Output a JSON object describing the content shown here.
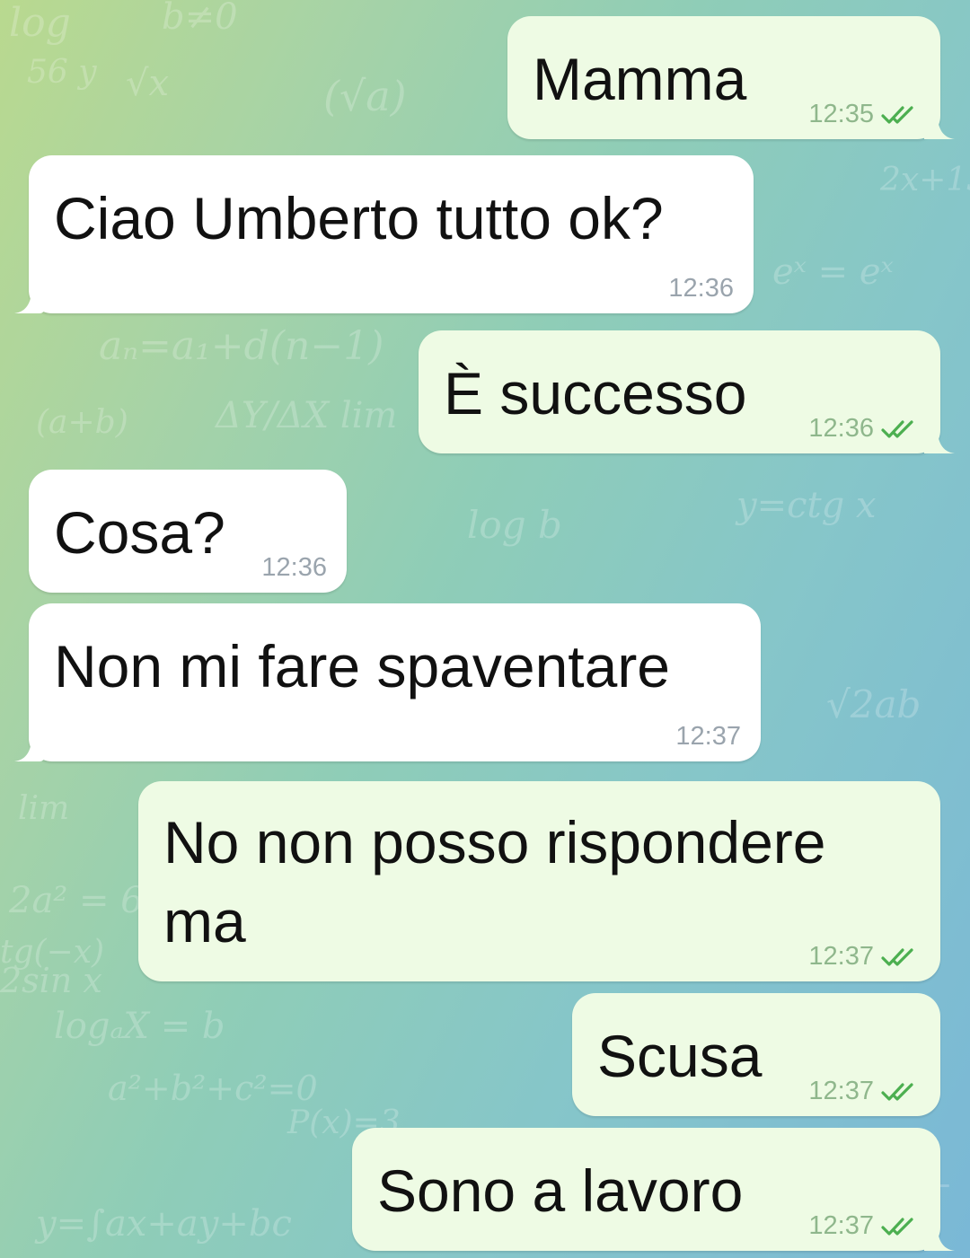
{
  "chat": {
    "messages": [
      {
        "text": "Mamma",
        "time": "12:35",
        "direction": "out",
        "status": "read"
      },
      {
        "text": "Ciao Umberto tutto ok?",
        "time": "12:36",
        "direction": "in"
      },
      {
        "text": "È successo",
        "time": "12:36",
        "direction": "out",
        "status": "read"
      },
      {
        "text": "Cosa?",
        "time": "12:36",
        "direction": "in"
      },
      {
        "text": "Non mi fare spaventare",
        "time": "12:37",
        "direction": "in"
      },
      {
        "text": "No non posso rispondere\nma",
        "time": "12:37",
        "direction": "out",
        "status": "read"
      },
      {
        "text": "Scusa",
        "time": "12:37",
        "direction": "out",
        "status": "read"
      },
      {
        "text": "Sono a lavoro",
        "time": "12:37",
        "direction": "out",
        "status": "read"
      }
    ]
  },
  "icons": {
    "read_receipt": "double-check-icon"
  },
  "colors": {
    "outgoing_bubble": "#eefbe4",
    "incoming_bubble": "#ffffff",
    "check": "#4caf50"
  }
}
